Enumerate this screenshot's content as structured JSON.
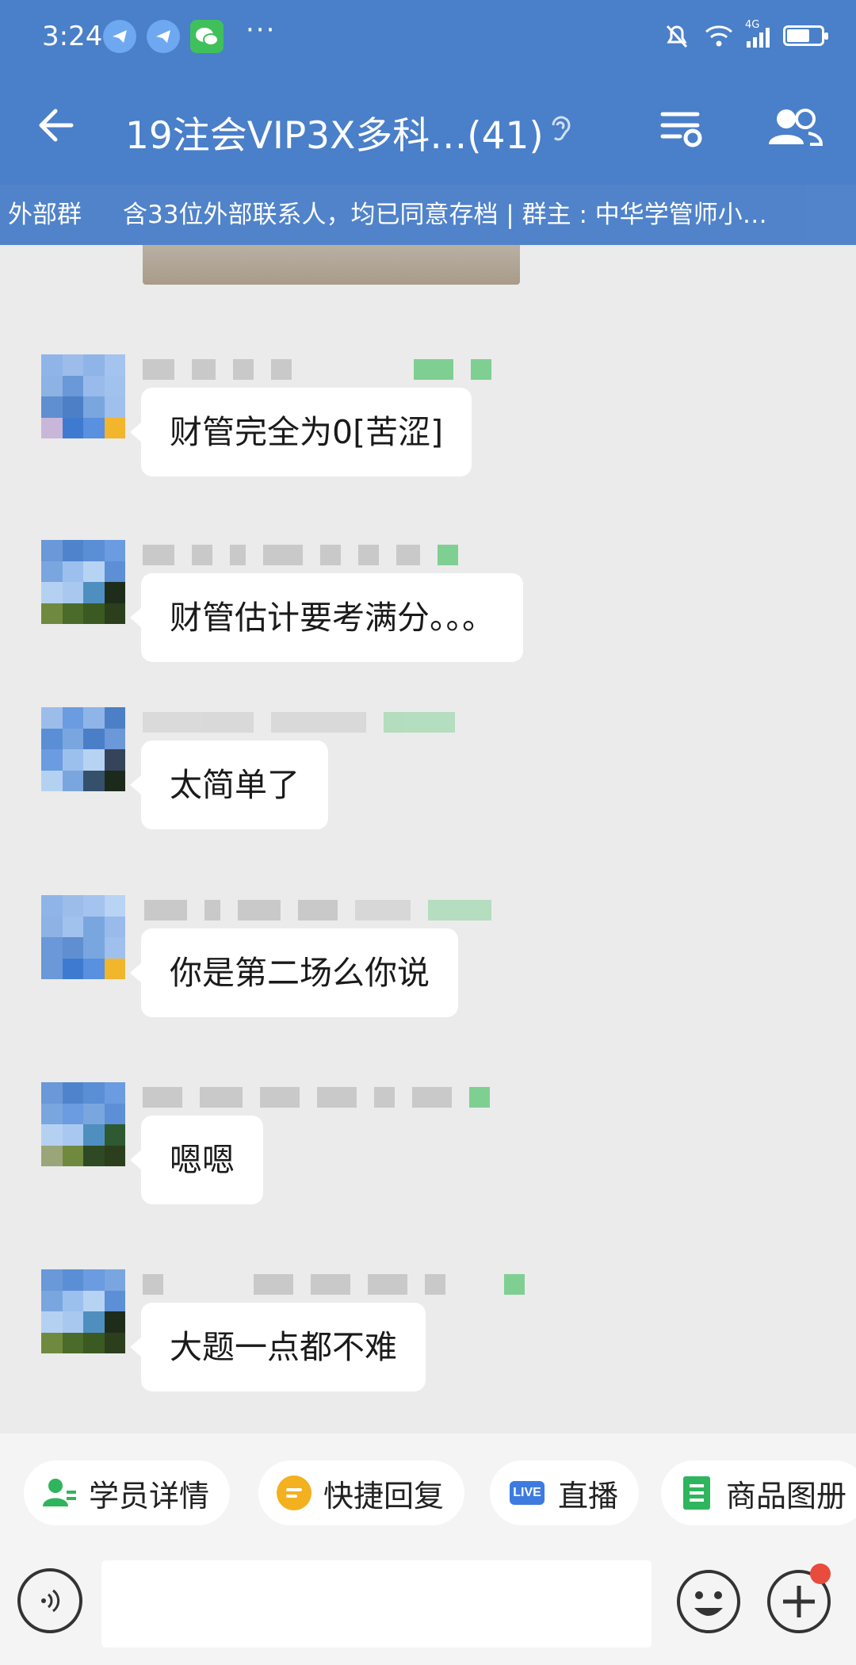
{
  "status_bar": {
    "time": "3:24",
    "network": "4G",
    "icons": [
      "telegram-icon",
      "telegram-icon",
      "wechat-icon",
      "mute-bell-icon",
      "wifi-icon",
      "signal-icon",
      "battery-icon"
    ]
  },
  "nav": {
    "title": "19注会VIP3X多科…(41)",
    "icons": [
      "back-arrow-icon",
      "ear-icon",
      "menu-icon",
      "people-icon"
    ]
  },
  "banner": {
    "tag": "外部群",
    "text": "含33位外部联系人，均已同意存档 | 群主 : 中华学管师小…"
  },
  "messages": [
    {
      "text": "财管完全为0[苦涩]"
    },
    {
      "text": "财管估计要考满分。。。"
    },
    {
      "text": "太简单了"
    },
    {
      "text": "你是第二场么你说"
    },
    {
      "text": "嗯嗯"
    },
    {
      "text": "大题一点都不难"
    }
  ],
  "quick_actions": [
    {
      "label": "学员详情",
      "icon": "student-icon"
    },
    {
      "label": "快捷回复",
      "icon": "quick-reply-icon"
    },
    {
      "label": "直播",
      "icon": "live-icon",
      "badge": "LIVE"
    },
    {
      "label": "商品图册",
      "icon": "catalog-icon"
    }
  ],
  "colors": {
    "header": "#4a7fc9",
    "chat_bg": "#ebebeb",
    "accent_green": "#2fb55d",
    "unread_dot": "#e94b3c"
  }
}
